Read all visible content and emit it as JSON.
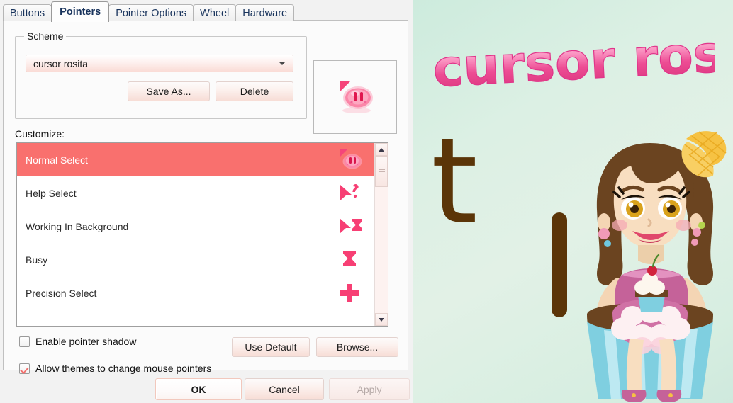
{
  "dialog": {
    "tabs": [
      {
        "label": "Buttons",
        "active": false
      },
      {
        "label": "Pointers",
        "active": true
      },
      {
        "label": "Pointer Options",
        "active": false
      },
      {
        "label": "Wheel",
        "active": false
      },
      {
        "label": "Hardware",
        "active": false
      }
    ],
    "scheme": {
      "legend": "Scheme",
      "selected_value": "cursor rosita",
      "save_as_label": "Save As...",
      "delete_label": "Delete",
      "preview_icon": "pink-pig-cursor-icon"
    },
    "customize": {
      "label": "Customize:",
      "rows": [
        {
          "label": "Normal Select",
          "icon": "pink-pig-cursor-icon",
          "selected": true
        },
        {
          "label": "Help Select",
          "icon": "arrow-question-cursor-icon",
          "selected": false
        },
        {
          "label": "Working In Background",
          "icon": "arrow-hourglass-cursor-icon",
          "selected": false
        },
        {
          "label": "Busy",
          "icon": "hourglass-cursor-icon",
          "selected": false
        },
        {
          "label": "Precision Select",
          "icon": "cross-cursor-icon",
          "selected": false
        }
      ]
    },
    "options": {
      "enable_pointer_shadow": {
        "label": "Enable pointer shadow",
        "checked": false
      },
      "allow_themes": {
        "label": "Allow themes to change mouse pointers",
        "checked": true
      },
      "use_default_label": "Use Default",
      "browse_label": "Browse..."
    },
    "footer": {
      "ok_label": "OK",
      "cancel_label": "Cancel",
      "apply_label": "Apply",
      "apply_disabled": true
    },
    "colors": {
      "selection": "#f9706e",
      "accent_pink": "#f2716e",
      "button_gradient_bottom": "#f7ddd6"
    }
  },
  "wallpaper": {
    "title_text": "cursor rosita",
    "letter_t": "t",
    "letter_l": "l",
    "illustration": "cupcake-girl-illustration",
    "colors": {
      "background_mint": "#dcf0e4",
      "title_pink": "#f0609f",
      "letter_brown": "#5b3508"
    }
  }
}
